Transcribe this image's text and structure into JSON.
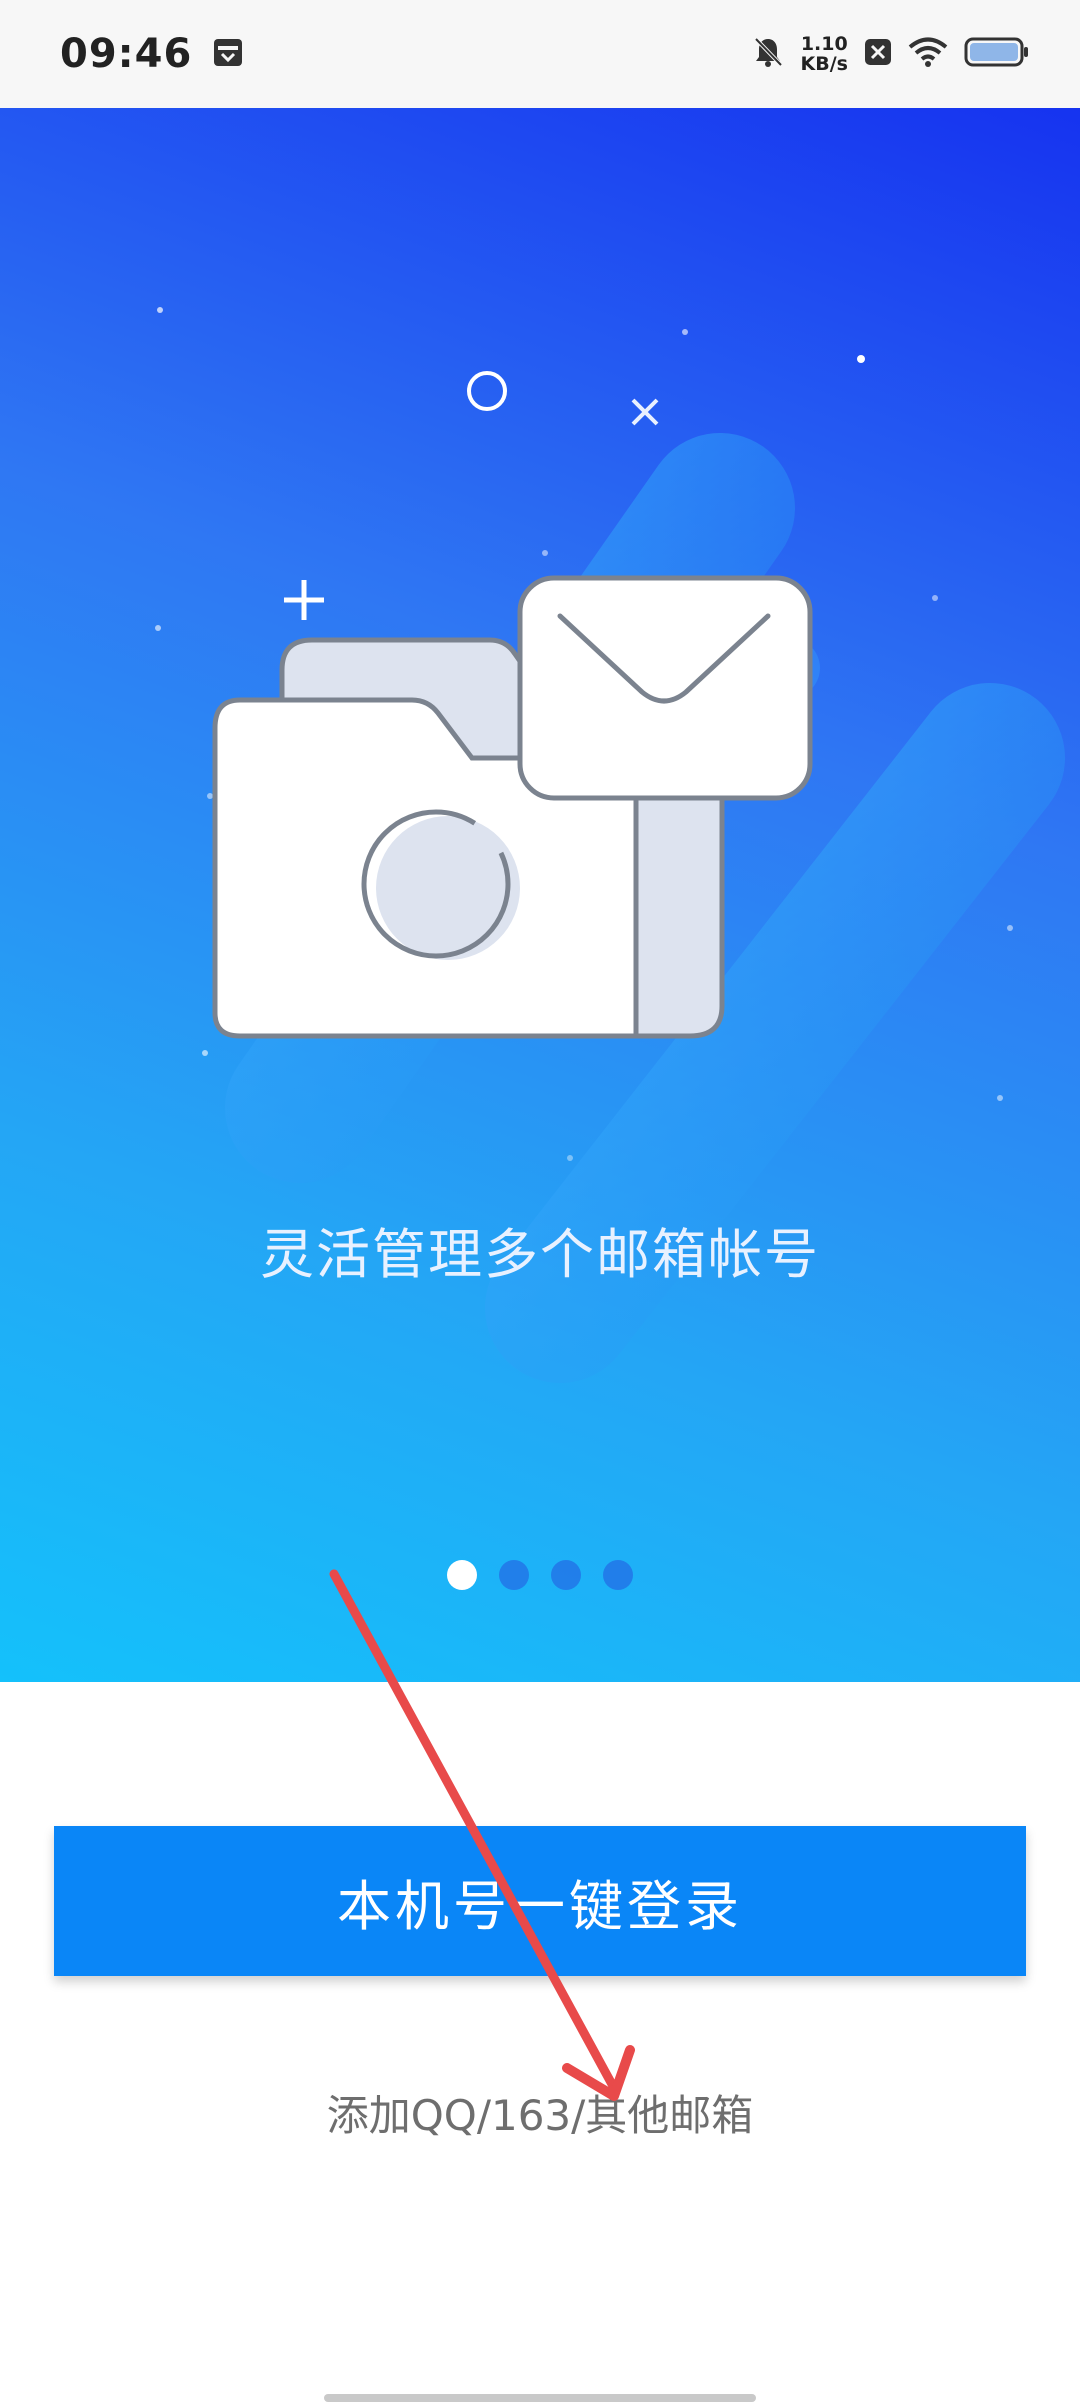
{
  "status_bar": {
    "time": "09:46",
    "net_speed_value": "1.10",
    "net_speed_unit": "KB/s",
    "icons": [
      "calendar-icon",
      "mute-bell-icon",
      "close-box-icon",
      "wifi-icon",
      "battery-icon"
    ]
  },
  "hero": {
    "tagline": "灵活管理多个邮箱帐号",
    "illustration": "folder-camera-envelope",
    "page_indicator": {
      "total": 4,
      "active": 1
    }
  },
  "actions": {
    "login_label": "本机号一键登录",
    "add_mailbox_label": "添加QQ/163/其他邮箱"
  },
  "colors": {
    "primary_button": "#0a86f7",
    "annotation_arrow": "#e84a4a",
    "link_text": "#6e6e6e"
  }
}
